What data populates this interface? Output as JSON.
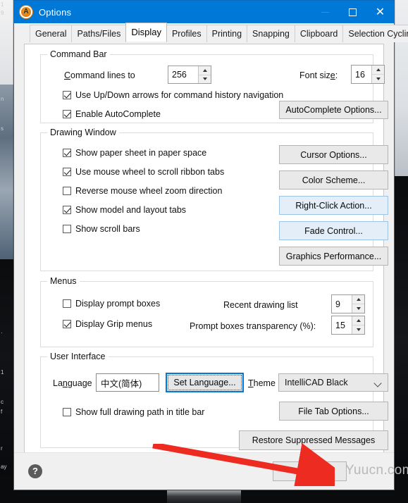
{
  "window": {
    "title": "Options",
    "app_icon": "intellicad-app-icon",
    "minimize_label": "Minimize",
    "maximize_label": "Maximize",
    "close_label": "Close",
    "titlebar_color": "#0078d7"
  },
  "tabs": [
    {
      "label": "General",
      "active": false
    },
    {
      "label": "Paths/Files",
      "active": false
    },
    {
      "label": "Display",
      "active": true
    },
    {
      "label": "Profiles",
      "active": false
    },
    {
      "label": "Printing",
      "active": false
    },
    {
      "label": "Snapping",
      "active": false
    },
    {
      "label": "Clipboard",
      "active": false
    },
    {
      "label": "Selection Cycling",
      "active": false
    }
  ],
  "command_bar": {
    "legend": "Command Bar",
    "command_lines_label": "Command lines to",
    "command_lines_value": "256",
    "font_size_label": "Font size:",
    "font_size_value": "16",
    "check_updown": "Use Up/Down arrows for command history navigation",
    "check_autocomplete": "Enable AutoComplete",
    "autocomplete_button": "AutoComplete Options..."
  },
  "drawing_window": {
    "legend": "Drawing Window",
    "check_paper_sheet": "Show paper sheet in paper space",
    "check_mouse_wheel": "Use mouse wheel to scroll ribbon tabs",
    "check_reverse_zoom": "Reverse mouse wheel zoom direction",
    "check_model_layout": "Show model and layout tabs",
    "check_scroll_bars": "Show scroll bars",
    "btn_cursor": "Cursor Options...",
    "btn_color_scheme": "Color Scheme...",
    "btn_right_click": "Right-Click Action...",
    "btn_fade_control": "Fade Control...",
    "btn_graphics": "Graphics Performance..."
  },
  "menus": {
    "legend": "Menus",
    "check_prompt_boxes": "Display prompt boxes",
    "check_grip_menus": "Display Grip menus",
    "recent_drawing_label": "Recent drawing list",
    "recent_drawing_value": "9",
    "transparency_label": "Prompt boxes transparency (%):",
    "transparency_value": "15"
  },
  "user_interface": {
    "legend": "User Interface",
    "language_label": "Language",
    "language_value": "中文(简体)",
    "set_language_button": "Set Language...",
    "theme_label": "Theme",
    "theme_value": "IntelliCAD Black",
    "check_full_path": "Show full drawing path in title bar",
    "btn_file_tab": "File Tab Options...",
    "btn_restore_messages": "Restore Suppressed Messages"
  },
  "footer": {
    "help_icon": "help-question-icon",
    "ok_button": "OK",
    "watermark": "Yuucn.com"
  },
  "annotation": {
    "arrow_color": "#ee2b21",
    "arrow_points_to": "ok-button"
  },
  "background": {
    "edge_labels": [
      "1",
      "9",
      "n",
      "s",
      "-",
      "1",
      "c",
      "f",
      "r",
      "ay"
    ]
  }
}
